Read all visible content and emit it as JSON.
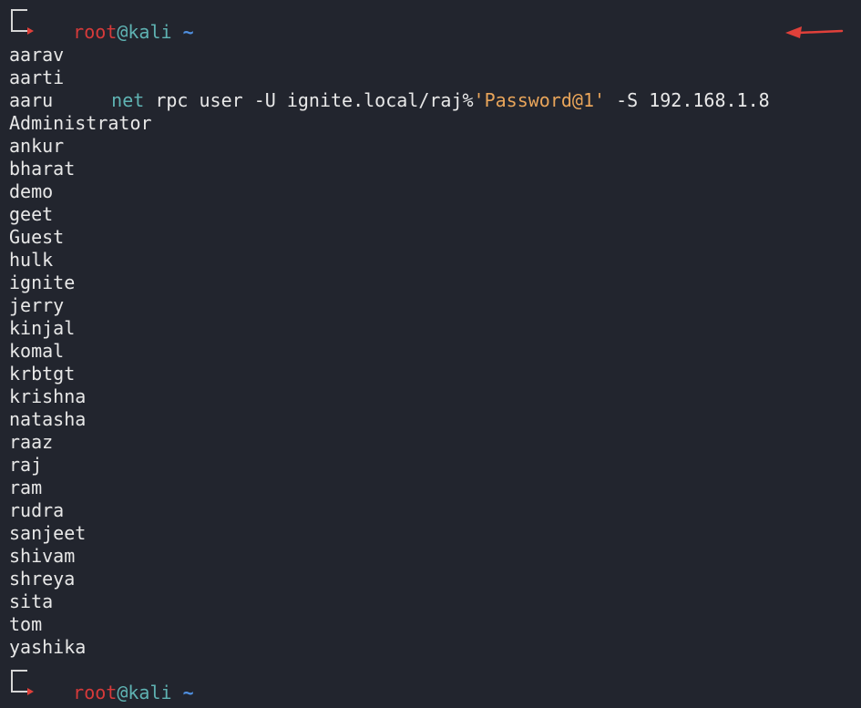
{
  "prompt": {
    "user": "root",
    "at": "@",
    "host": "kali",
    "path": "~"
  },
  "command": {
    "name": "net",
    "args": " rpc user -U ignite.local/raj%",
    "password": "'Password@1'",
    "rest": " -S 192.168.1.8"
  },
  "output": [
    "aarav",
    "aarti",
    "aaru",
    "Administrator",
    "ankur",
    "bharat",
    "demo",
    "geet",
    "Guest",
    "hulk",
    "ignite",
    "jerry",
    "kinjal",
    "komal",
    "krbtgt",
    "krishna",
    "natasha",
    "raaz",
    "raj",
    "ram",
    "rudra",
    "sanjeet",
    "shivam",
    "shreya",
    "sita",
    "tom",
    "yashika"
  ],
  "colors": {
    "background": "#22252e",
    "user": "#d63a3a",
    "host": "#5fb3b3",
    "string": "#e9a55a",
    "annotation_arrow": "#e0403a"
  }
}
